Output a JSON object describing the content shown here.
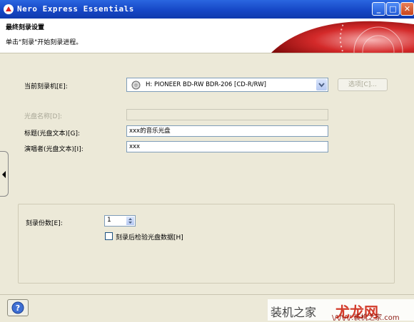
{
  "window": {
    "title": "Nero Express Essentials",
    "buttons": {
      "minimize": "_",
      "maximize": "□",
      "close": "✕"
    }
  },
  "header": {
    "title": "最终刻录设置",
    "subtitle": "单击\"刻录\"开始刻录进程。"
  },
  "form": {
    "recorder_label": "当前刻录机[E]:",
    "recorder_value": "H: PIONEER BD-RW   BDR-206   [CD-R/RW]",
    "options_button": "选项[C]...",
    "disc_name_label": "光盘名称[D]:",
    "disc_name_value": "",
    "title_label": "标题(光盘文本)[G]:",
    "title_value": "xxx的音乐光盘",
    "artist_label": "演唱者(光盘文本)[I]:",
    "artist_value": "xxx"
  },
  "burn": {
    "copies_label": "刻录份数[E]:",
    "copies_value": "1",
    "verify_label": "刻录后检验光盘数据[H]",
    "verify_checked": false
  },
  "footer": {
    "help_icon": "help-icon"
  },
  "watermark": {
    "text": "装机之家",
    "logo": "尤龙网",
    "url": "\\/\\/\\/\\/.装机之家.com"
  },
  "colors": {
    "titlebar": "#1647c6",
    "background": "#ece9d8",
    "accent_red": "#c4161c"
  }
}
